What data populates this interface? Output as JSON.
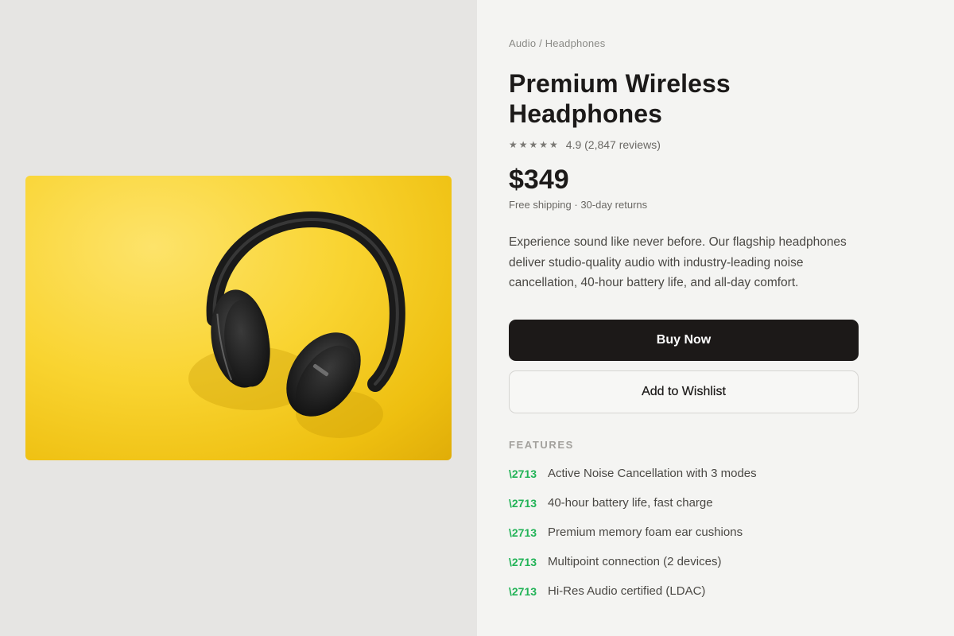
{
  "breadcrumb": {
    "category": "Audio",
    "separator": "/",
    "subcategory": "Headphones"
  },
  "product": {
    "title": "Premium Wireless Headphones",
    "stars": "★★★★★",
    "rating": 4.9,
    "rating_text": "4.9 (2,847 reviews)",
    "price": "$349",
    "shipping_info": "Free shipping · 30-day returns",
    "description": "Experience sound like never before. Our flagship headphones deliver studio-quality audio with industry-leading noise cancellation, 40-hour battery life, and all-day comfort.",
    "image_icon": "headphones-photo"
  },
  "actions": {
    "buy_label": "Buy Now",
    "wishlist_label": "Add to Wishlist"
  },
  "features": {
    "heading": "FEATURES",
    "check_glyph": "\\2713",
    "items": [
      "Active Noise Cancellation with 3 modes",
      "40-hour battery life, fast charge",
      "Premium memory foam ear cushions",
      "Multipoint connection (2 devices)",
      "Hi-Res Audio certified (LDAC)"
    ]
  },
  "colors": {
    "left_background": "#e6e5e3",
    "right_background": "#f4f4f2",
    "image_background": "#f9d431",
    "buy_button": "#1c1918",
    "check_accent": "#22b357"
  }
}
